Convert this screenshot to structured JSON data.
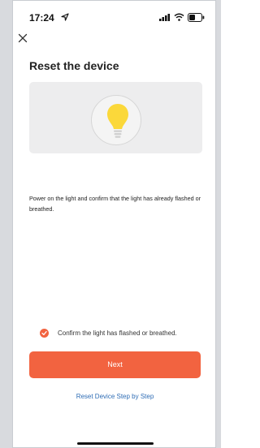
{
  "status_bar": {
    "time": "17:24"
  },
  "page": {
    "title": "Reset the device"
  },
  "instruction": "Power on the light and confirm that the light has already flashed or breathed.",
  "confirm": {
    "label": "Confirm the light has flashed or breathed.",
    "checked": true
  },
  "actions": {
    "next_label": "Next",
    "reset_link": "Reset Device Step by Step"
  },
  "colors": {
    "accent": "#f26340",
    "link": "#2f6db5",
    "bulb": "#fbd83a",
    "illustration_bg": "#ededee"
  },
  "icons": {
    "close": "close-icon",
    "location": "location-arrow-icon",
    "signal": "cellular-signal-icon",
    "wifi": "wifi-icon",
    "battery": "battery-icon",
    "bulb": "light-bulb-icon",
    "check": "check-icon"
  }
}
